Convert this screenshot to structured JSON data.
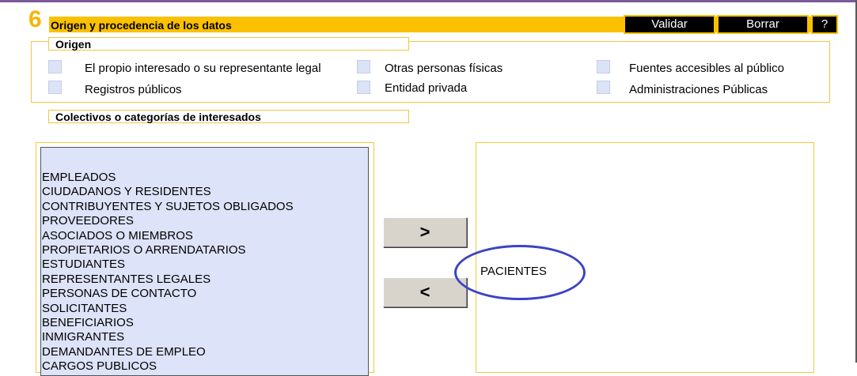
{
  "section": {
    "number": "6",
    "title": "Origen y procedencia de los datos",
    "buttons": {
      "validate": "Validar",
      "clear": "Borrar",
      "help": "?"
    }
  },
  "origen": {
    "label": "Origen",
    "options": [
      {
        "label": "El propio interesado o su representante legal",
        "checked": false
      },
      {
        "label": "Registros públicos",
        "checked": false
      },
      {
        "label": "Otras personas físicas",
        "checked": false
      },
      {
        "label": "Entidad privada",
        "checked": false
      },
      {
        "label": "Fuentes accesibles al público",
        "checked": false
      },
      {
        "label": "Administraciones Públicas",
        "checked": false
      }
    ]
  },
  "colectivos": {
    "label": "Colectivos o categorías de interesados",
    "available": [
      "EMPLEADOS",
      "CIUDADANOS Y RESIDENTES",
      "CONTRIBUYENTES Y SUJETOS OBLIGADOS",
      "PROVEEDORES",
      "ASOCIADOS O MIEMBROS",
      "PROPIETARIOS O ARRENDATARIOS",
      "ESTUDIANTES",
      "REPRESENTANTES LEGALES",
      "PERSONAS DE CONTACTO",
      "SOLICITANTES",
      "BENEFICIARIOS",
      "INMIGRANTES",
      "DEMANDANTES DE EMPLEO",
      "CARGOS PUBLICOS"
    ],
    "selected": [
      "PACIENTES"
    ],
    "move_right": ">",
    "move_left": "<"
  },
  "colors": {
    "accent": "#fbc100",
    "section_number": "#f7b500",
    "list_bg": "#dde3f8",
    "annotation": "#3a44c4"
  }
}
